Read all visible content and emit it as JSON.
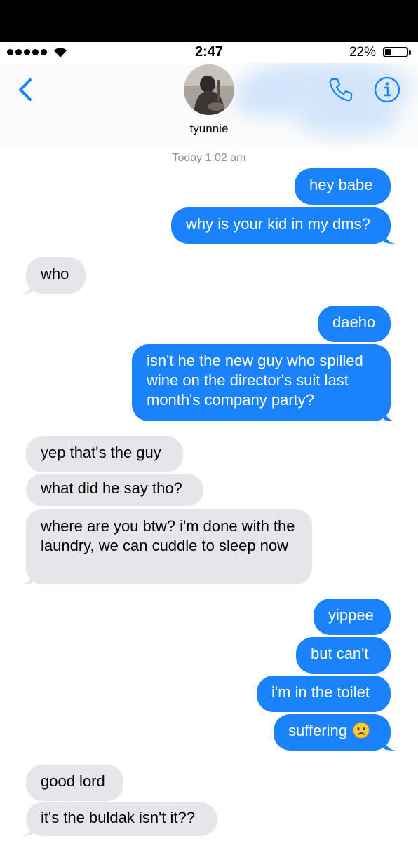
{
  "status_bar": {
    "time": "2:47",
    "battery": "22%"
  },
  "header": {
    "contact_name": "tyunnie"
  },
  "conversation": {
    "timestamp": "Today 1:02 am"
  },
  "messages": [
    {
      "from": "me",
      "text": "hey babe"
    },
    {
      "from": "me",
      "text": "why is your kid in my dms?"
    },
    {
      "from": "them",
      "text": "who"
    },
    {
      "from": "me",
      "text": "daeho"
    },
    {
      "from": "me",
      "text": "isn't he the new guy who spilled wine on the director's suit last month's company party?"
    },
    {
      "from": "them",
      "text": "yep that's the guy"
    },
    {
      "from": "them",
      "text": "what did he say tho?"
    },
    {
      "from": "them",
      "text": "where are you btw? i'm done with the laundry, we can cuddle to sleep now"
    },
    {
      "from": "me",
      "text": "yippee"
    },
    {
      "from": "me",
      "text": "but can't"
    },
    {
      "from": "me",
      "text": "i'm in the toilet"
    },
    {
      "from": "me",
      "text": "suffering",
      "emoji": "crying-face-emoji"
    },
    {
      "from": "them",
      "text": "good lord"
    },
    {
      "from": "them",
      "text": "it's the buldak isn't it??"
    }
  ],
  "colors": {
    "sent_bubble": "#1a82fb",
    "received_bubble": "#e5e5ea",
    "accent": "#1a82fb"
  }
}
